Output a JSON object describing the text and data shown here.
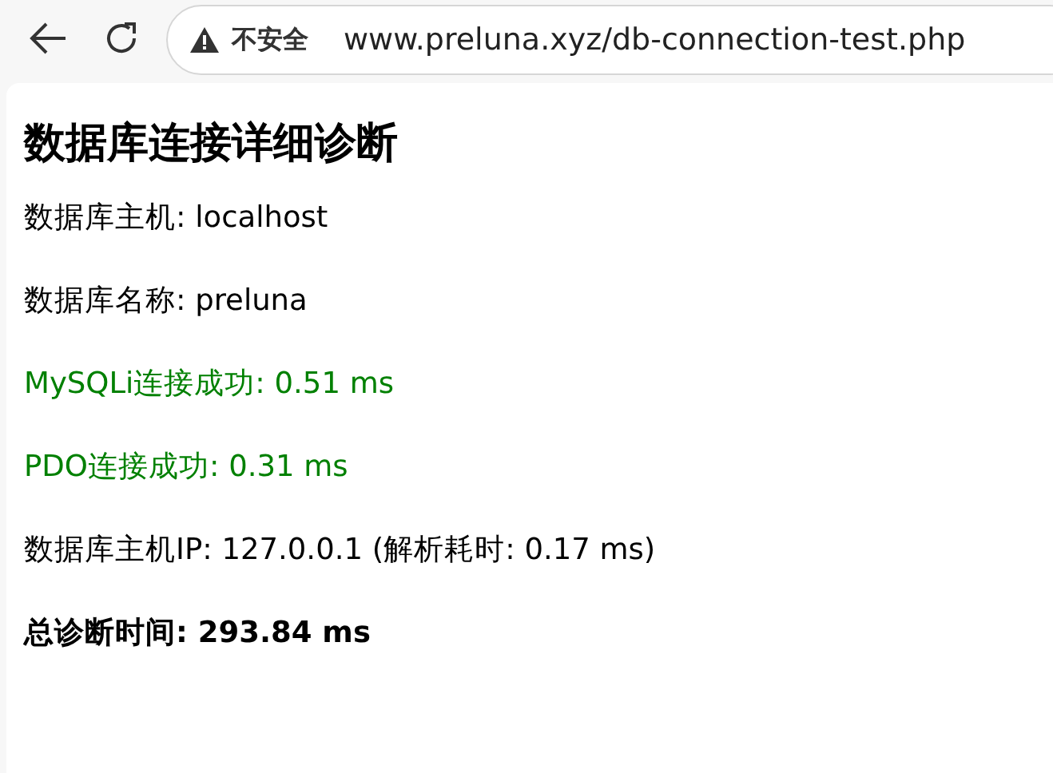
{
  "browser": {
    "security_label": "不安全",
    "url": "www.preluna.xyz/db-connection-test.php"
  },
  "page": {
    "heading": "数据库连接详细诊断",
    "lines": [
      {
        "kind": "plain",
        "text": "数据库主机: localhost"
      },
      {
        "kind": "plain",
        "text": "数据库名称: preluna"
      },
      {
        "kind": "success",
        "text": "MySQLi连接成功: 0.51 ms"
      },
      {
        "kind": "success",
        "text": "PDO连接成功: 0.31 ms"
      },
      {
        "kind": "plain",
        "text": "数据库主机IP: 127.0.0.1 (解析耗时: 0.17 ms)"
      },
      {
        "kind": "total",
        "text": "总诊断时间: 293.84 ms"
      }
    ]
  }
}
